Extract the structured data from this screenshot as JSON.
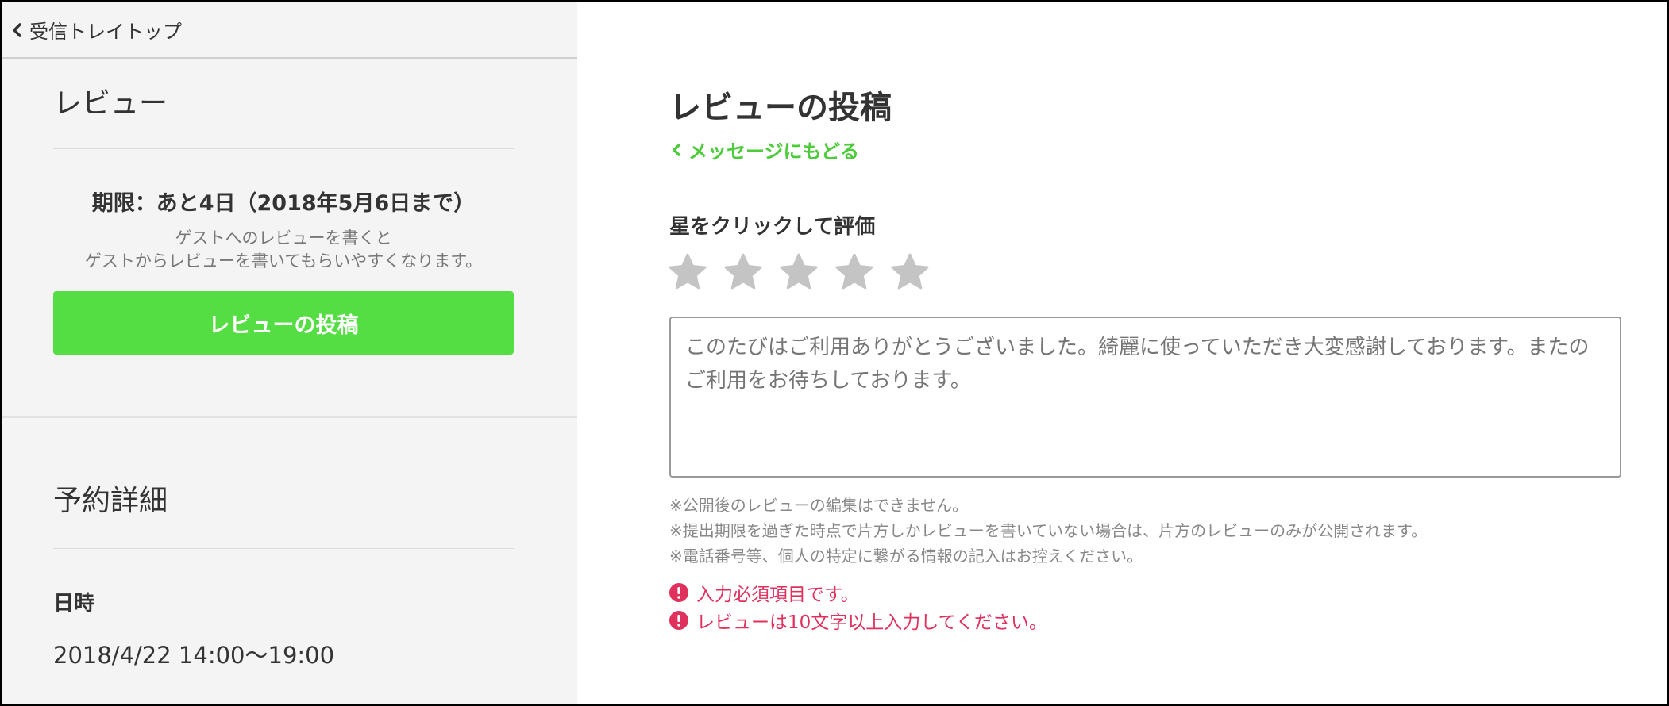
{
  "sidebar": {
    "back_label": "受信トレイトップ",
    "review_section": {
      "title": "レビュー",
      "deadline": "期限：あと4日（2018年5月6日まで）",
      "hint_line1": "ゲストへのレビューを書くと",
      "hint_line2": "ゲストからレビューを書いてもらいやすくなります。",
      "button_label": "レビューの投稿"
    },
    "reservation_section": {
      "title": "予約詳細",
      "datetime_label": "日時",
      "datetime_value": "2018/4/22 14:00〜19:00"
    }
  },
  "main": {
    "title": "レビューの投稿",
    "back_link": "メッセージにもどる",
    "rating_label": "星をクリックして評価",
    "rating": {
      "value": 0,
      "max": 5
    },
    "review_placeholder": "このたびはご利用ありがとうございました。綺麗に使っていただき大変感謝しております。またのご利用をお待ちしております。",
    "notes": [
      "※公開後のレビューの編集はできません。",
      "※提出期限を過ぎた時点で片方しかレビューを書いていない場合は、片方のレビューのみが公開されます。",
      "※電話番号等、個人の特定に繋がる情報の記入はお控えください。"
    ],
    "errors": [
      "入力必須項目です。",
      "レビューは10文字以上入力してください。"
    ]
  },
  "colors": {
    "accent_green": "#55dd44",
    "link_green": "#4ccc3a",
    "error_red": "#e0315d",
    "star_inactive": "#c4c4c4"
  },
  "icons": [
    "chevron-left-icon",
    "star-icon",
    "error-circle-icon"
  ]
}
